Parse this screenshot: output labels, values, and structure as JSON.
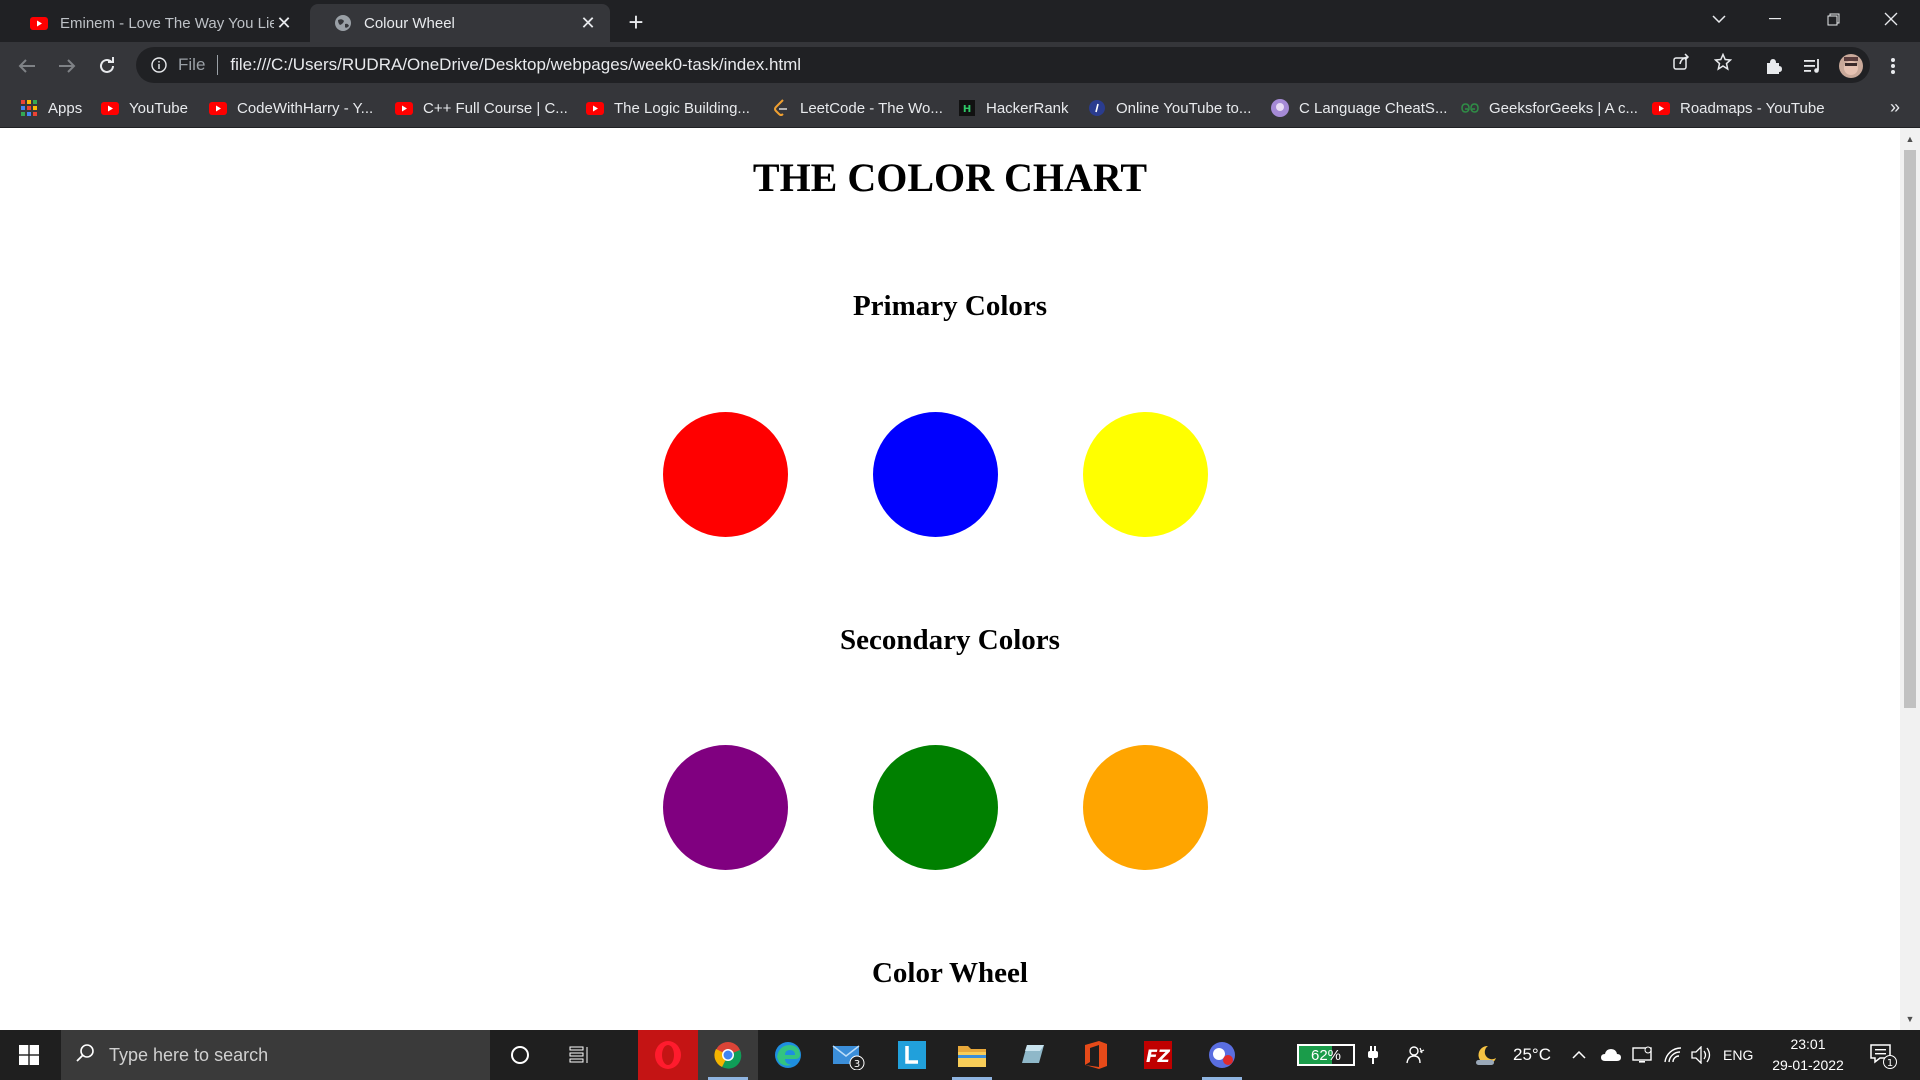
{
  "browser": {
    "tabs": [
      {
        "title": "Eminem - Love The Way You Lie (",
        "active": false
      },
      {
        "title": "Colour Wheel",
        "active": true
      }
    ],
    "url_scheme": "File",
    "url": "file:///C:/Users/RUDRA/OneDrive/Desktop/webpages/week0-task/index.html",
    "bookmarks": [
      "Apps",
      "YouTube",
      "CodeWithHarry - Y...",
      "C++ Full Course | C...",
      "The Logic Building...",
      "LeetCode - The Wo...",
      "HackerRank",
      "Online YouTube to...",
      "C Language CheatS...",
      "GeeksforGeeks | A c...",
      "Roadmaps - YouTube"
    ],
    "more": "»"
  },
  "page": {
    "title": "THE COLOR CHART",
    "sections": [
      {
        "heading": "Primary Colors",
        "colors": [
          "#ff0000",
          "#0000ff",
          "#ffff00"
        ]
      },
      {
        "heading": "Secondary Colors",
        "colors": [
          "#800080",
          "#008000",
          "#ffa500"
        ]
      },
      {
        "heading": "Color Wheel",
        "colors": []
      }
    ]
  },
  "taskbar": {
    "search_placeholder": "Type here to search",
    "mail_badge": "3",
    "battery": {
      "text": "62%",
      "level": 0.62
    },
    "weather": "25°C",
    "language": "ENG",
    "time": "23:01",
    "date": "29-01-2022",
    "notifications": "1"
  },
  "colors": {
    "tabstrip": "#202124",
    "toolbar": "#35363a",
    "youtube_red": "#ff0000"
  }
}
